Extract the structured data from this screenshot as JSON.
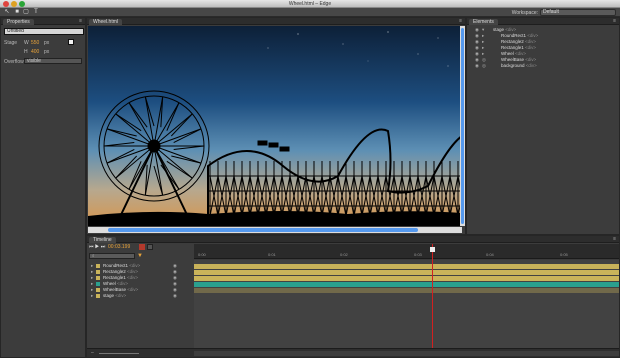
{
  "window": {
    "title": "Wheel.html – Edge"
  },
  "workspace": {
    "label": "Workspace:",
    "value": "Default"
  },
  "properties": {
    "tab": "Properties",
    "name_value": "Untitled",
    "stage_label": "Stage",
    "w_label": "W",
    "w_value": "550",
    "w_unit": "px",
    "h_label": "H",
    "h_value": "400",
    "h_unit": "px",
    "overflow_label": "Overflow",
    "overflow_value": "visible"
  },
  "stage": {
    "tab": "Wheel.html"
  },
  "elements": {
    "tab": "Elements",
    "root": "stage",
    "root_tag": "<div>",
    "items": [
      {
        "name": "RoundRect1",
        "tag": "<div>"
      },
      {
        "name": "Rectangle2",
        "tag": "<div>"
      },
      {
        "name": "Rectangle1",
        "tag": "<div>"
      },
      {
        "name": "Wheel",
        "tag": "<div>"
      },
      {
        "name": "WheelBase",
        "tag": "<div>"
      },
      {
        "name": "background",
        "tag": "<div>"
      }
    ]
  },
  "timeline": {
    "tab": "Timeline",
    "time": "00:03.199",
    "ticks": [
      "0:00",
      "0:01",
      "0:02",
      "0:03",
      "0:04",
      "0:05"
    ],
    "rows": [
      {
        "name": "RoundRect1",
        "tag": "<div>",
        "color": "#c9b35a"
      },
      {
        "name": "Rectangle2",
        "tag": "<div>",
        "color": "#c9b35a"
      },
      {
        "name": "Rectangle1",
        "tag": "<div>",
        "color": "#c9b35a"
      },
      {
        "name": "Wheel",
        "tag": "<div>",
        "color": "#2aa08e"
      },
      {
        "name": "WheelBase",
        "tag": "<div>",
        "color": "#c9b35a"
      },
      {
        "name": "stage",
        "tag": "<div>",
        "color": "#c9b35a"
      }
    ]
  },
  "colors": {
    "accent": "#e8a33a",
    "playhead": "#d12020",
    "scrollbar": "#5599ee"
  }
}
